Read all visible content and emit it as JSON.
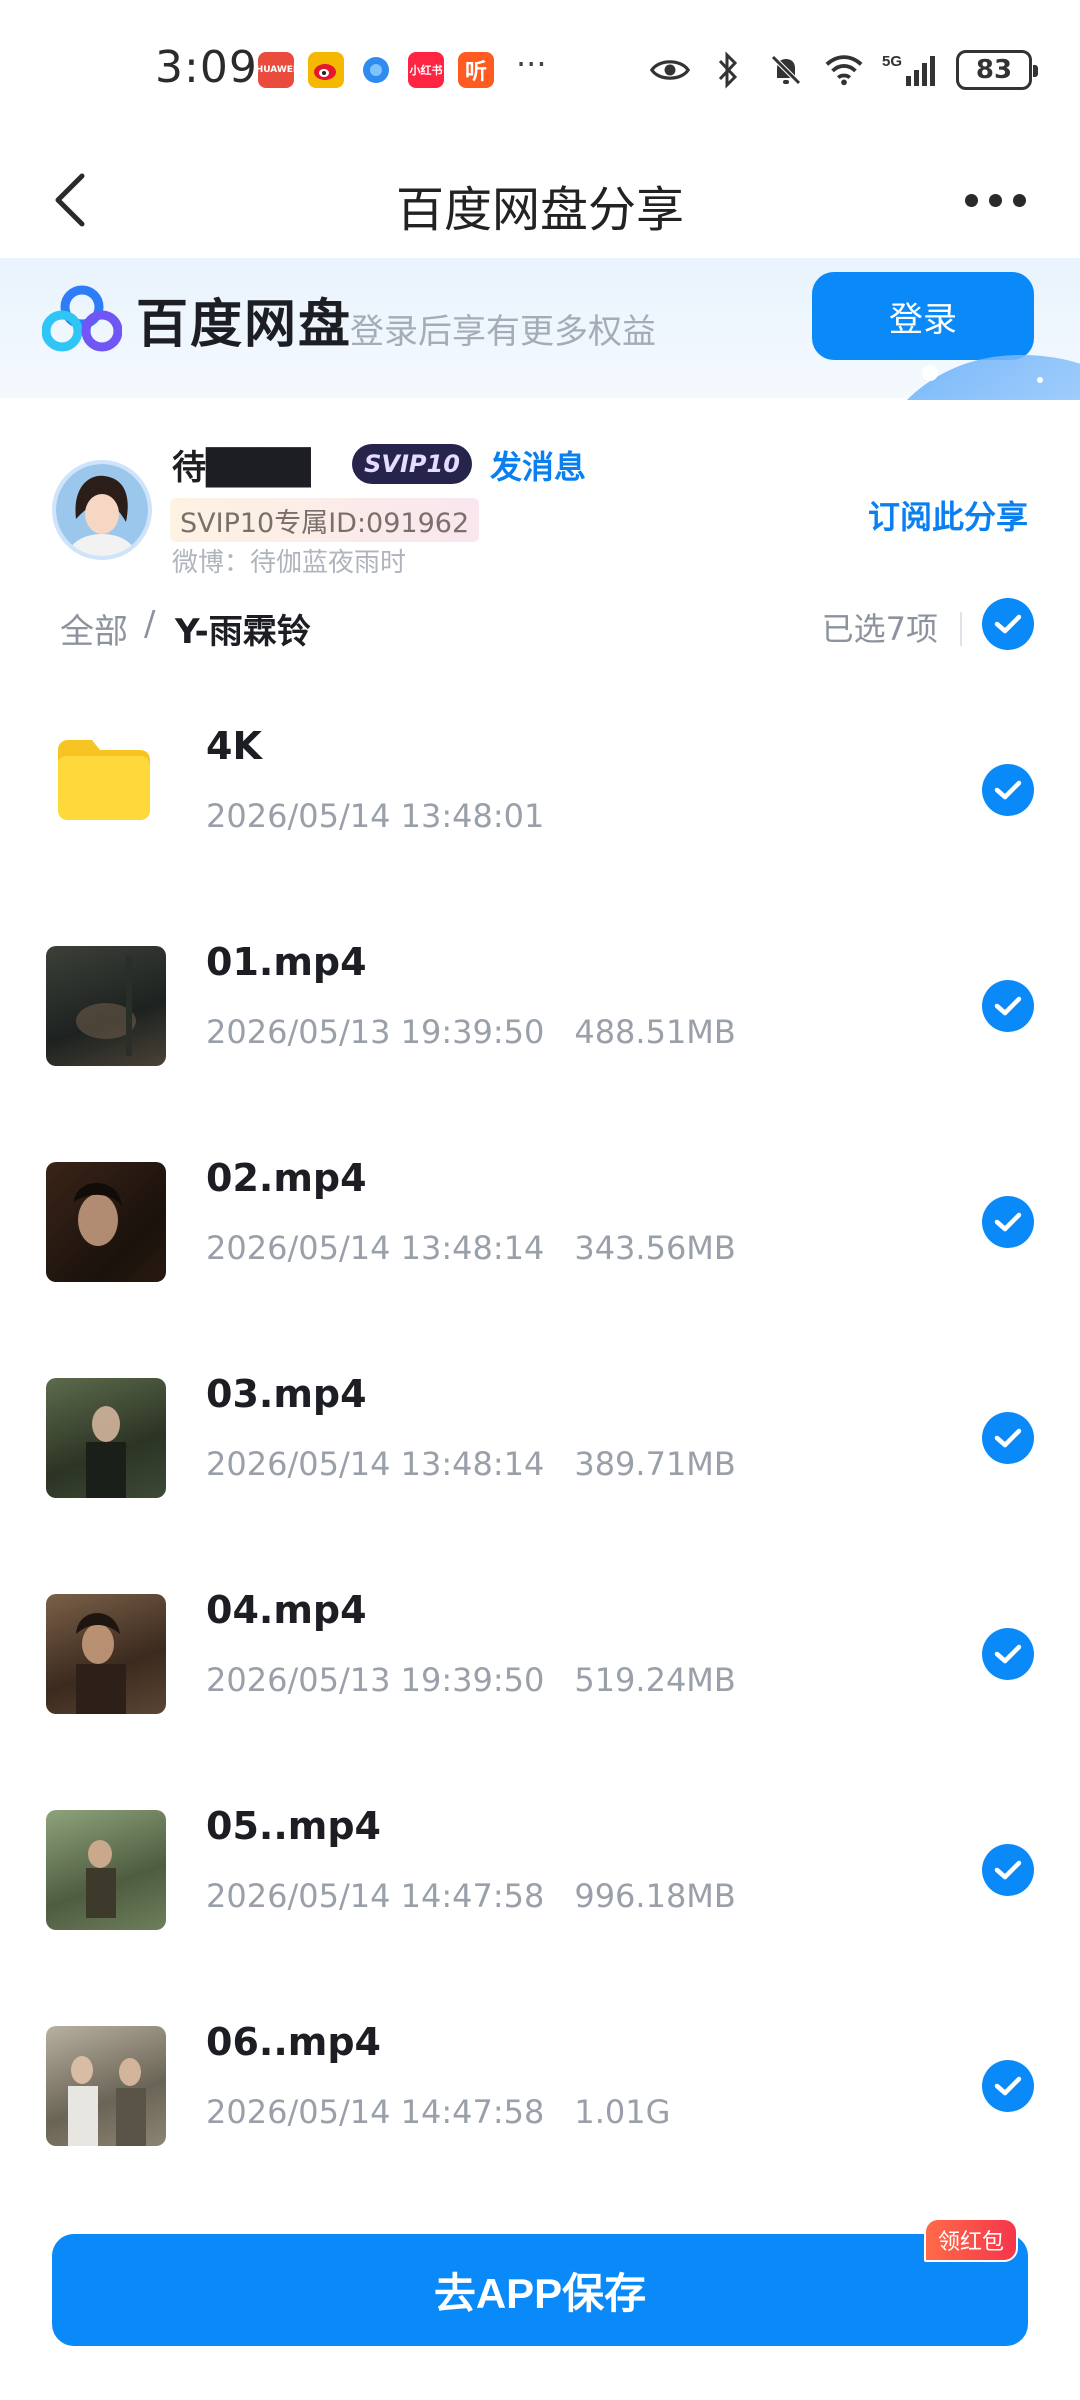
{
  "status_bar": {
    "time": "3:09",
    "apps": [
      {
        "name": "huawei-icon",
        "label": "HUAWEI",
        "color": "#e94b3c"
      },
      {
        "name": "weibo-icon",
        "label": "",
        "color": "#f5b800"
      },
      {
        "name": "browser-icon",
        "label": "",
        "color": "#2e8cf0"
      },
      {
        "name": "xiaohongshu-icon",
        "label": "小红书",
        "color": "#ff2442"
      },
      {
        "name": "listen-icon",
        "label": "听",
        "color": "#ff5a1f"
      }
    ],
    "more": "···",
    "network": "5G",
    "battery": "83"
  },
  "nav": {
    "title": "百度网盘分享"
  },
  "banner": {
    "brand": "百度网盘",
    "tip": "登录后享有更多权益",
    "login_label": "登录"
  },
  "sharer": {
    "name": "待████",
    "badge": "SVIP10",
    "message_label": "发消息",
    "member_id": "SVIP10专属ID:091962",
    "weibo": "微博：待伽蓝夜雨时",
    "subscribe_label": "订阅此分享"
  },
  "breadcrumb": {
    "all_label": "全部",
    "separator": "/",
    "current": "Y-雨霖铃",
    "selected_label": "已选7项"
  },
  "files": [
    {
      "name": "4K",
      "date": "2026/05/14 13:48:01",
      "size": "",
      "type": "folder",
      "checked": true
    },
    {
      "name": "01.mp4",
      "date": "2026/05/13 19:39:50",
      "size": "488.51MB",
      "type": "video",
      "checked": true
    },
    {
      "name": "02.mp4",
      "date": "2026/05/14 13:48:14",
      "size": "343.56MB",
      "type": "video",
      "checked": true
    },
    {
      "name": "03.mp4",
      "date": "2026/05/14 13:48:14",
      "size": "389.71MB",
      "type": "video",
      "checked": true
    },
    {
      "name": "04.mp4",
      "date": "2026/05/13 19:39:50",
      "size": "519.24MB",
      "type": "video",
      "checked": true
    },
    {
      "name": "05..mp4",
      "date": "2026/05/14 14:47:58",
      "size": "996.18MB",
      "type": "video",
      "checked": true
    },
    {
      "name": "06..mp4",
      "date": "2026/05/14 14:47:58",
      "size": "1.01G",
      "type": "video",
      "checked": true
    }
  ],
  "bottom": {
    "save_label": "去APP保存",
    "redpacket_label": "领红包"
  },
  "colors": {
    "accent": "#0a8af8",
    "badge_bg": "#27244c",
    "redpacket": "#f5364a"
  }
}
